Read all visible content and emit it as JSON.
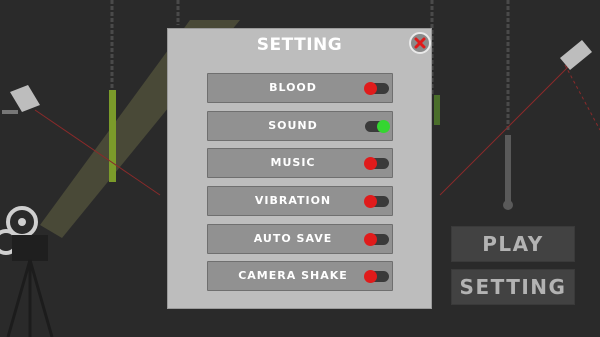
{
  "dialog": {
    "title": "SETTING",
    "options": [
      {
        "label": "BLOOD",
        "state": "off"
      },
      {
        "label": "SOUND",
        "state": "on"
      },
      {
        "label": "MUSIC",
        "state": "off"
      },
      {
        "label": "VIBRATION",
        "state": "off"
      },
      {
        "label": "AUTO SAVE",
        "state": "off"
      },
      {
        "label": "CAMERA SHAKE",
        "state": "off"
      }
    ]
  },
  "menu": {
    "play_label": "PLAY",
    "setting_label": "SETTING"
  },
  "colors": {
    "toggle_on": "#35d631",
    "toggle_off": "#e01b1b",
    "dialog_bg": "#bdbdbd",
    "row_bg": "#919191"
  }
}
